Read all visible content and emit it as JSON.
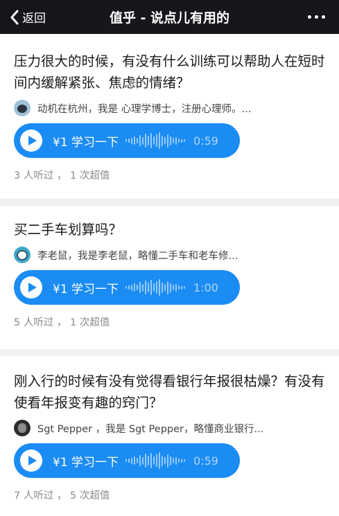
{
  "header": {
    "back_label": "返回",
    "title": "值乎 - 说点儿有用的"
  },
  "cards": [
    {
      "question": "压力很大的时候，有没有什么训练可以帮助人在短时间内缓解紧张、焦虑的情绪？",
      "author": "动机在杭州，我是 心理学博士，注册心理师。...",
      "price_label": "¥1 学习一下",
      "duration": "0:59",
      "stats": "3 人听过 ， 1 次超值"
    },
    {
      "question": "买二手车划算吗？",
      "author": "李老鼠，我是李老鼠，略懂二手车和老车修...",
      "price_label": "¥1 学习一下",
      "duration": "1:00",
      "stats": "5 人听过 ， 1 次超值"
    },
    {
      "question": "刚入行的时候有没有觉得看银行年报很枯燥？有没有使看年报变有趣的窍门？",
      "author": "Sgt Pepper ，我是 Sgt Pepper，略懂商业银行...",
      "price_label": "¥1 学习一下",
      "duration": "0:59",
      "stats": "7 人听过 ， 5 次超值"
    }
  ],
  "icons": {
    "back": "chevron-left-icon",
    "more": "more-dots-icon",
    "play": "play-icon",
    "wave": "waveform-icon"
  },
  "colors": {
    "topbar": "#17161b",
    "audio_button": "#1b8cf3",
    "background": "#f0f0f2"
  }
}
